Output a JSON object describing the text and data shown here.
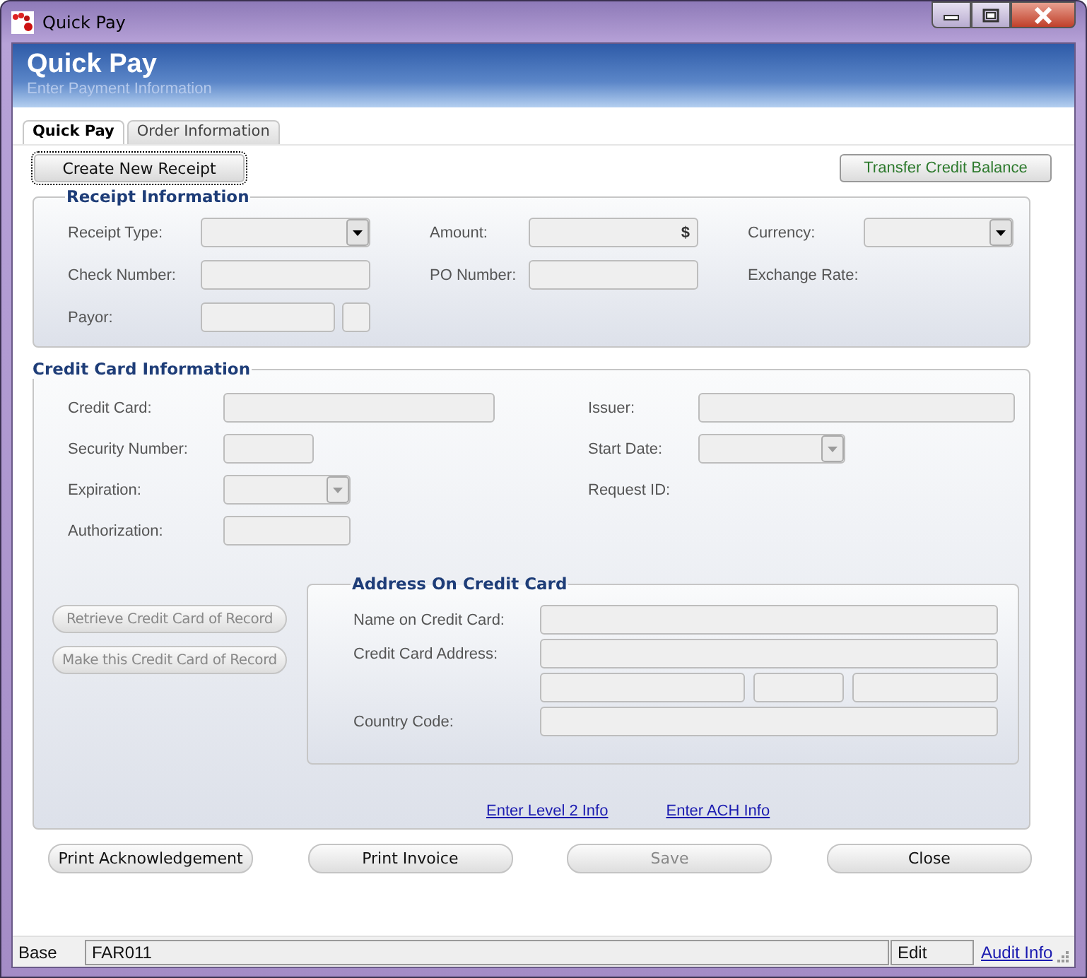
{
  "window": {
    "title": "Quick Pay"
  },
  "header": {
    "title": "Quick Pay",
    "subtitle": "Enter Payment Information"
  },
  "tabs": [
    {
      "label": "Quick Pay",
      "selected": true
    },
    {
      "label": "Order Information",
      "selected": false
    }
  ],
  "toolbar": [
    {
      "label": "Create New Receipt",
      "focused": true
    },
    {
      "label": "Transfer Credit Balance",
      "focused": false
    }
  ],
  "receipt_information": {
    "title": "Receipt Information",
    "rows": [
      [
        {
          "label": "Receipt Type:",
          "kind": "dropdown",
          "disabled": false
        },
        {
          "label": "Amount:",
          "kind": "currency",
          "symbol": "$"
        },
        {
          "label": "Currency:",
          "kind": "dropdown",
          "disabled": false
        }
      ],
      [
        {
          "label": "Check Number:",
          "kind": "text"
        },
        {
          "label": "PO Number:",
          "kind": "text"
        },
        {
          "label": "Exchange Rate:",
          "kind": "label"
        }
      ],
      [
        {
          "label": "Payor:",
          "kind": "payor"
        }
      ]
    ]
  },
  "credit_card_information": {
    "title": "Credit Card Information",
    "rows": [
      [
        {
          "label": "Credit Card:",
          "kind": "text"
        },
        {
          "label": "Issuer:",
          "kind": "text"
        }
      ],
      [
        {
          "label": "Security Number:",
          "kind": "text"
        },
        {
          "label": "Start Date:",
          "kind": "dropdown",
          "disabled": true
        }
      ],
      [
        {
          "label": "Expiration:",
          "kind": "dropdown",
          "disabled": true
        },
        {
          "label": "Request ID:",
          "kind": "label"
        }
      ],
      [
        {
          "label": "Authorization:",
          "kind": "text"
        }
      ]
    ],
    "buttons": [
      {
        "label": "Retrieve Credit Card of Record",
        "disabled": true
      },
      {
        "label": "Make this Credit Card of Record",
        "disabled": true
      }
    ],
    "address": {
      "title": "Address On Credit Card",
      "rows": [
        {
          "label": "Name on Credit Card:",
          "kind": "text"
        },
        {
          "label": "Credit Card Address:",
          "kind": "text"
        },
        {
          "kind": "split"
        },
        {
          "label": "Country Code:",
          "kind": "text"
        }
      ]
    },
    "links": [
      "Enter Level 2 Info",
      "Enter ACH Info"
    ]
  },
  "buttons": [
    {
      "label": "Print Acknowledgement",
      "disabled": false
    },
    {
      "label": "Print Invoice",
      "disabled": false
    },
    {
      "label": "Save",
      "disabled": true
    },
    {
      "label": "Close",
      "disabled": false
    }
  ],
  "status_bar": {
    "mode": "Base",
    "form": "FAR011",
    "state": "Edit",
    "link": "Audit Info"
  }
}
